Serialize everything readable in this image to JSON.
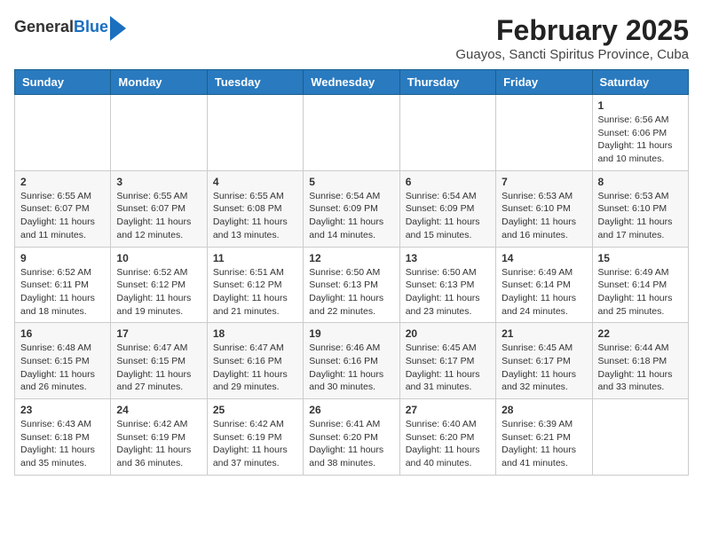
{
  "header": {
    "logo_general": "General",
    "logo_blue": "Blue",
    "title": "February 2025",
    "subtitle": "Guayos, Sancti Spiritus Province, Cuba"
  },
  "weekdays": [
    "Sunday",
    "Monday",
    "Tuesday",
    "Wednesday",
    "Thursday",
    "Friday",
    "Saturday"
  ],
  "weeks": [
    [
      {
        "day": "",
        "info": ""
      },
      {
        "day": "",
        "info": ""
      },
      {
        "day": "",
        "info": ""
      },
      {
        "day": "",
        "info": ""
      },
      {
        "day": "",
        "info": ""
      },
      {
        "day": "",
        "info": ""
      },
      {
        "day": "1",
        "info": "Sunrise: 6:56 AM\nSunset: 6:06 PM\nDaylight: 11 hours and 10 minutes."
      }
    ],
    [
      {
        "day": "2",
        "info": "Sunrise: 6:55 AM\nSunset: 6:07 PM\nDaylight: 11 hours and 11 minutes."
      },
      {
        "day": "3",
        "info": "Sunrise: 6:55 AM\nSunset: 6:07 PM\nDaylight: 11 hours and 12 minutes."
      },
      {
        "day": "4",
        "info": "Sunrise: 6:55 AM\nSunset: 6:08 PM\nDaylight: 11 hours and 13 minutes."
      },
      {
        "day": "5",
        "info": "Sunrise: 6:54 AM\nSunset: 6:09 PM\nDaylight: 11 hours and 14 minutes."
      },
      {
        "day": "6",
        "info": "Sunrise: 6:54 AM\nSunset: 6:09 PM\nDaylight: 11 hours and 15 minutes."
      },
      {
        "day": "7",
        "info": "Sunrise: 6:53 AM\nSunset: 6:10 PM\nDaylight: 11 hours and 16 minutes."
      },
      {
        "day": "8",
        "info": "Sunrise: 6:53 AM\nSunset: 6:10 PM\nDaylight: 11 hours and 17 minutes."
      }
    ],
    [
      {
        "day": "9",
        "info": "Sunrise: 6:52 AM\nSunset: 6:11 PM\nDaylight: 11 hours and 18 minutes."
      },
      {
        "day": "10",
        "info": "Sunrise: 6:52 AM\nSunset: 6:12 PM\nDaylight: 11 hours and 19 minutes."
      },
      {
        "day": "11",
        "info": "Sunrise: 6:51 AM\nSunset: 6:12 PM\nDaylight: 11 hours and 21 minutes."
      },
      {
        "day": "12",
        "info": "Sunrise: 6:50 AM\nSunset: 6:13 PM\nDaylight: 11 hours and 22 minutes."
      },
      {
        "day": "13",
        "info": "Sunrise: 6:50 AM\nSunset: 6:13 PM\nDaylight: 11 hours and 23 minutes."
      },
      {
        "day": "14",
        "info": "Sunrise: 6:49 AM\nSunset: 6:14 PM\nDaylight: 11 hours and 24 minutes."
      },
      {
        "day": "15",
        "info": "Sunrise: 6:49 AM\nSunset: 6:14 PM\nDaylight: 11 hours and 25 minutes."
      }
    ],
    [
      {
        "day": "16",
        "info": "Sunrise: 6:48 AM\nSunset: 6:15 PM\nDaylight: 11 hours and 26 minutes."
      },
      {
        "day": "17",
        "info": "Sunrise: 6:47 AM\nSunset: 6:15 PM\nDaylight: 11 hours and 27 minutes."
      },
      {
        "day": "18",
        "info": "Sunrise: 6:47 AM\nSunset: 6:16 PM\nDaylight: 11 hours and 29 minutes."
      },
      {
        "day": "19",
        "info": "Sunrise: 6:46 AM\nSunset: 6:16 PM\nDaylight: 11 hours and 30 minutes."
      },
      {
        "day": "20",
        "info": "Sunrise: 6:45 AM\nSunset: 6:17 PM\nDaylight: 11 hours and 31 minutes."
      },
      {
        "day": "21",
        "info": "Sunrise: 6:45 AM\nSunset: 6:17 PM\nDaylight: 11 hours and 32 minutes."
      },
      {
        "day": "22",
        "info": "Sunrise: 6:44 AM\nSunset: 6:18 PM\nDaylight: 11 hours and 33 minutes."
      }
    ],
    [
      {
        "day": "23",
        "info": "Sunrise: 6:43 AM\nSunset: 6:18 PM\nDaylight: 11 hours and 35 minutes."
      },
      {
        "day": "24",
        "info": "Sunrise: 6:42 AM\nSunset: 6:19 PM\nDaylight: 11 hours and 36 minutes."
      },
      {
        "day": "25",
        "info": "Sunrise: 6:42 AM\nSunset: 6:19 PM\nDaylight: 11 hours and 37 minutes."
      },
      {
        "day": "26",
        "info": "Sunrise: 6:41 AM\nSunset: 6:20 PM\nDaylight: 11 hours and 38 minutes."
      },
      {
        "day": "27",
        "info": "Sunrise: 6:40 AM\nSunset: 6:20 PM\nDaylight: 11 hours and 40 minutes."
      },
      {
        "day": "28",
        "info": "Sunrise: 6:39 AM\nSunset: 6:21 PM\nDaylight: 11 hours and 41 minutes."
      },
      {
        "day": "",
        "info": ""
      }
    ]
  ]
}
